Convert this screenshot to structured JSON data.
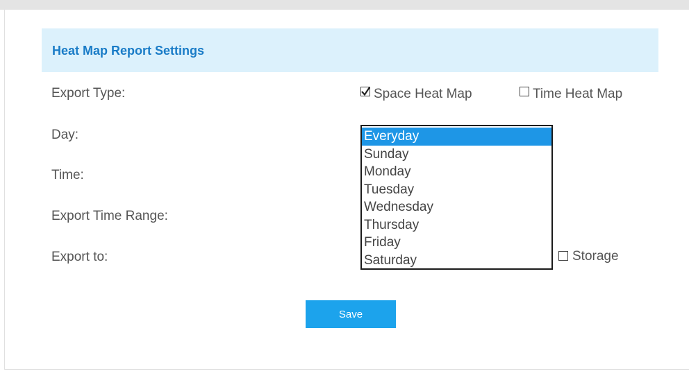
{
  "section": {
    "title": "Heat Map Report Settings"
  },
  "rows": {
    "export_type_label": "Export Type:",
    "day_label": "Day:",
    "time_label": "Time:",
    "export_time_range_label": "Export Time Range:",
    "export_to_label": "Export to:"
  },
  "export_type": {
    "space_heat_map": {
      "label": "Space Heat Map",
      "checked": true
    },
    "time_heat_map": {
      "label": "Time Heat Map",
      "checked": false
    }
  },
  "export_to": {
    "storage": {
      "label": "Storage",
      "checked": false
    }
  },
  "day_dropdown": {
    "selected": "Everyday",
    "options": [
      "Everyday",
      "Sunday",
      "Monday",
      "Tuesday",
      "Wednesday",
      "Thursday",
      "Friday",
      "Saturday"
    ]
  },
  "actions": {
    "save_label": "Save"
  },
  "colors": {
    "header_bg": "#dcf1fc",
    "title": "#1a7cc7",
    "selected_option": "#1e96e6",
    "button": "#1ca3ec"
  }
}
